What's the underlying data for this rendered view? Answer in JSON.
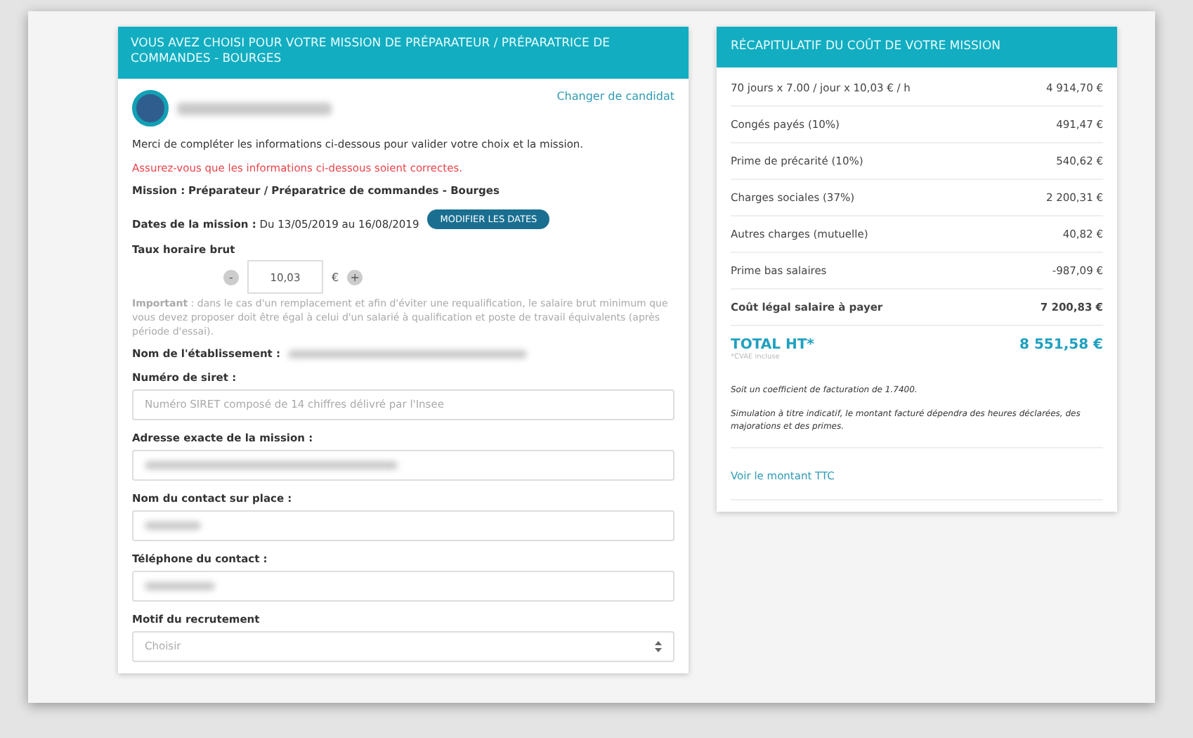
{
  "mission_form": {
    "header": "VOUS AVEZ CHOISI POUR VOTRE MISSION DE PRÉPARATEUR / PRÉPARATRICE DE COMMANDES - BOURGES",
    "change_candidate_link": "Changer de candidat",
    "intro": "Merci de compléter les informations ci-dessous pour valider votre choix et la mission.",
    "warning": "Assurez-vous que les informations ci-dessous soient correctes.",
    "mission_line": {
      "label": "Mission :",
      "value": "Préparateur / Préparatrice de commandes - Bourges"
    },
    "dates_line": {
      "label": "Dates de la mission :",
      "value": "Du 13/05/2019 au 16/08/2019",
      "button": "MODIFIER LES DATES"
    },
    "rate": {
      "label": "Taux horaire brut",
      "minus": "-",
      "value": "10,03",
      "unit": "€",
      "plus": "+"
    },
    "notice": "**Important** : dans le cas d'un remplacement et afin d'éviter une requalification, le salaire brut minimum que vous devez proposer doit être égal à celui d'un salarié à qualification et poste de travail équivalents (après période d'essai).",
    "establishment_label": "Nom de l'établissement :",
    "fields": [
      {
        "kind": "input",
        "label": "Numéro de siret :",
        "placeholder": "Numéro SIRET composé de 14 chiffres délivré par l'Insee"
      },
      {
        "kind": "input",
        "label": "Adresse exacte de la mission :"
      },
      {
        "kind": "input",
        "label": "Nom du contact sur place :"
      },
      {
        "kind": "input",
        "label": "Téléphone du contact :"
      },
      {
        "kind": "select",
        "label": "Motif du recrutement",
        "placeholder": "Choisir"
      }
    ]
  },
  "cost_summary": {
    "header": "RÉCAPITULATIF DU COÛT DE VOTRE MISSION",
    "rows": [
      {
        "kind": "line",
        "label": "70 jours x 7.00 / jour x 10,03 € / h",
        "amount": "4 914,70 €"
      },
      {
        "kind": "line",
        "label": "Congés payés (10%)",
        "amount": "491,47 €"
      },
      {
        "kind": "line",
        "label": "Prime de précarité (10%)",
        "amount": "540,62 €"
      },
      {
        "kind": "line",
        "label": "Charges sociales (37%)",
        "amount": "2 200,31 €"
      },
      {
        "kind": "line",
        "label": "Autres charges (mutuelle)",
        "amount": "40,82 €"
      },
      {
        "kind": "line",
        "label": "Prime bas salaires",
        "amount": "-987,09 €"
      },
      {
        "kind": "subtotal",
        "label": "Coût légal salaire à payer",
        "amount": "7 200,83 €"
      }
    ],
    "total": {
      "label": "TOTAL HT*",
      "amount": "8 551,58 €",
      "note": "*CVAE incluse"
    },
    "disclaimer": [
      "Soit un coefficient de facturation de 1.7400.",
      "Simulation à titre indicatif, le montant facturé dépendra des heures déclarées, des majorations et des primes."
    ],
    "ttc_link": "Voir le montant TTC"
  }
}
